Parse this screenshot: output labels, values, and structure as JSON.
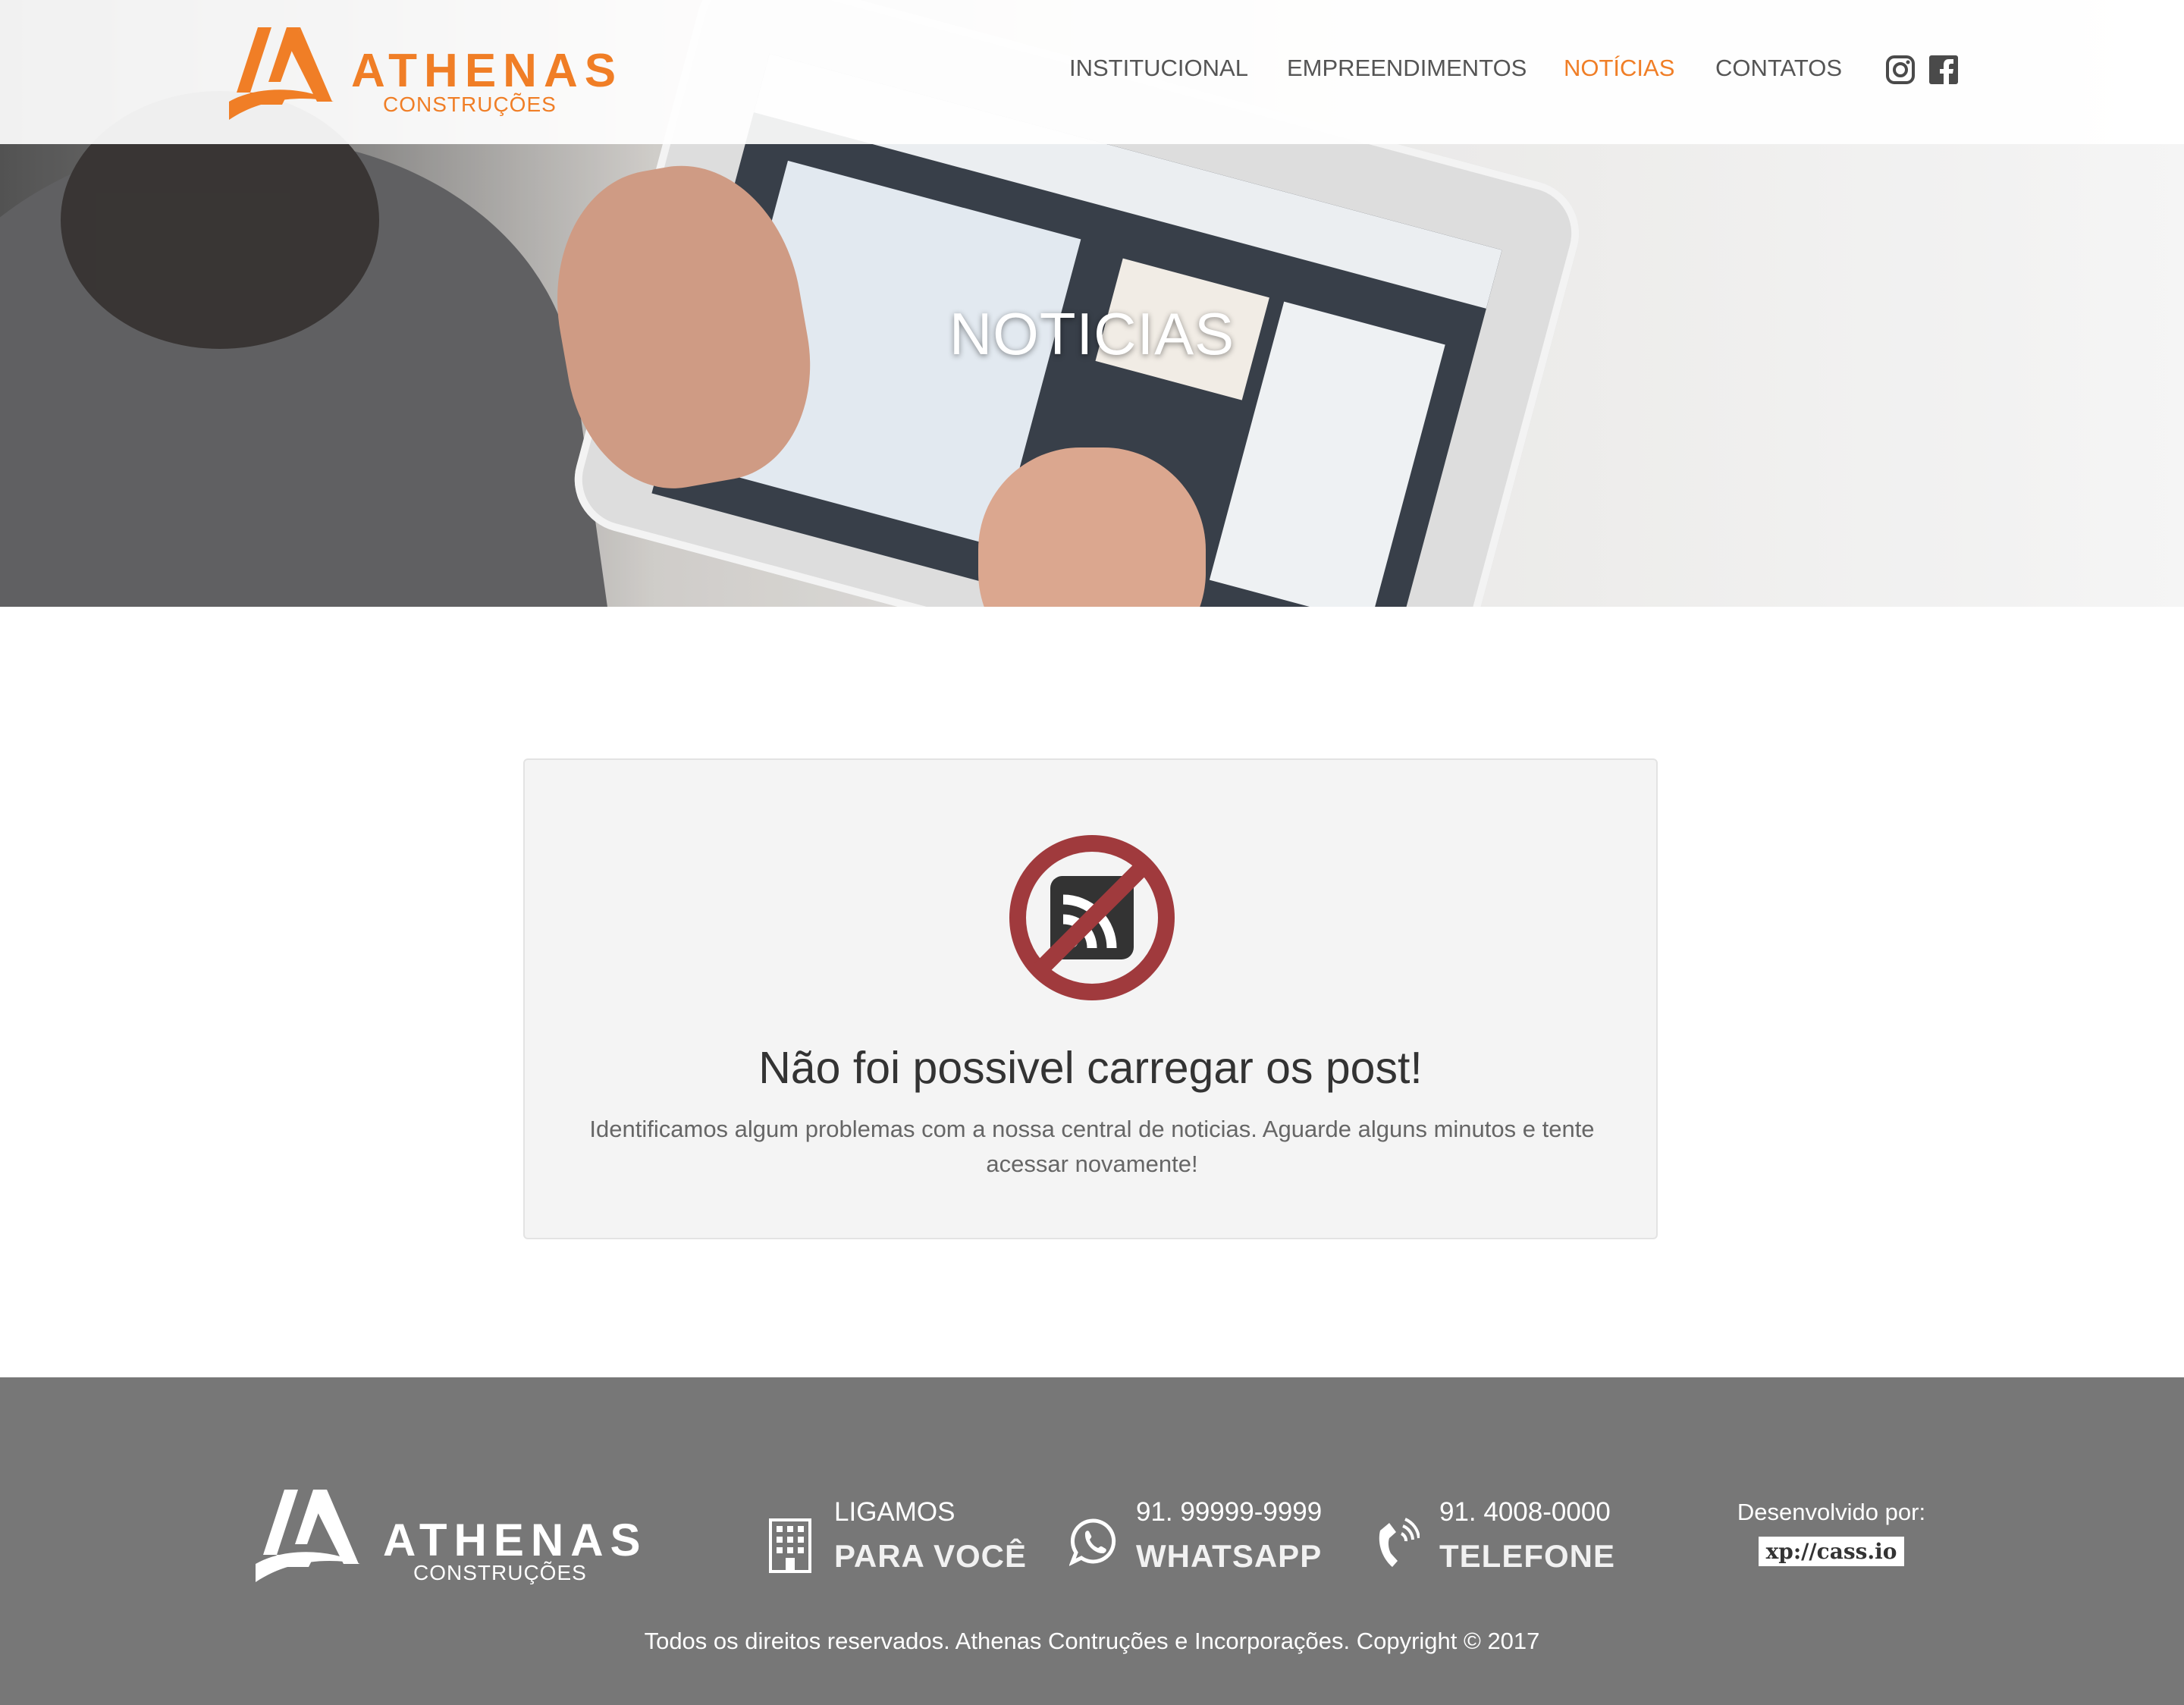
{
  "header": {
    "brand": "ATHENAS",
    "brand_sub": "CONSTRUÇÕES",
    "nav": [
      {
        "label": "INSTITUCIONAL"
      },
      {
        "label": "EMPREENDIMENTOS"
      },
      {
        "label": "NOTÍCIAS",
        "active": true
      },
      {
        "label": "CONTATOS"
      }
    ],
    "social": [
      "instagram-icon",
      "facebook-icon"
    ],
    "accent_color": "#f07e26"
  },
  "hero": {
    "title": "NOTICIAS"
  },
  "error_card": {
    "icon": "no-rss-icon",
    "title": "Não foi possivel carregar os post!",
    "message": "Identificamos algum problemas com a nossa central de noticias. Aguarde alguns minutos e tente acessar novamente!",
    "icon_color": "#a03a3d"
  },
  "footer": {
    "brand": "ATHENAS",
    "brand_sub": "CONSTRUÇÕES",
    "contacts": [
      {
        "icon": "building-icon",
        "line1": "LIGAMOS",
        "line2": "PARA VOCÊ"
      },
      {
        "icon": "whatsapp-icon",
        "line1": "91. 99999-9999",
        "line2": "WHATSAPP"
      },
      {
        "icon": "phone-icon",
        "line1": "91. 4008-0000",
        "line2": "TELEFONE"
      }
    ],
    "developer_label": "Desenvolvido por:",
    "developer_badge": "xp://cass.io",
    "copyright": "Todos os direitos reservados. Athenas Contruções e Incorporações. Copyright © 2017",
    "background": "#777777"
  }
}
